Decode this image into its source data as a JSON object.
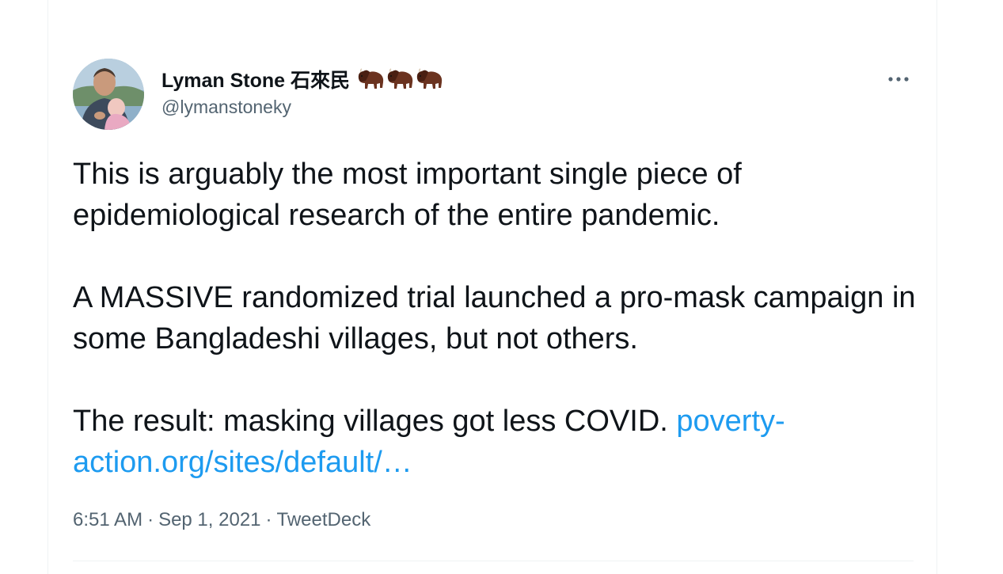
{
  "author": {
    "display_name": "Lyman Stone 石來民",
    "handle": "@lymanstoneky",
    "name_emoji": [
      "bison-icon",
      "bison-icon",
      "bison-icon"
    ]
  },
  "tweet": {
    "paragraph_1": "This is arguably the most important single piece of epidemiological research of the entire pandemic.",
    "paragraph_2": "A MASSIVE randomized trial launched a pro-mask campaign in some Bangladeshi villages, but not others.",
    "paragraph_3_text": "The result: masking villages got less COVID.",
    "link_text": "poverty-action.org/sites/default/…"
  },
  "meta": {
    "time": "6:51 AM",
    "separator": "·",
    "date": "Sep 1, 2021",
    "source": "TweetDeck"
  },
  "colors": {
    "text": "#0f1419",
    "secondary": "#536471",
    "link": "#1d9bf0",
    "border": "#eff3f4"
  }
}
